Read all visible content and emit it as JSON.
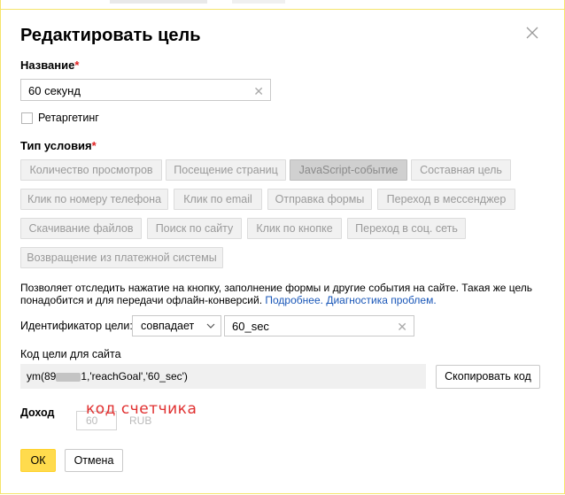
{
  "dialog": {
    "title": "Редактировать цель",
    "name_label": "Название",
    "required_mark": "*",
    "name_value": "60 секунд",
    "retargeting_label": "Ретаргетинг",
    "condition_label": "Тип условия",
    "condition_types": [
      "Количество просмотров",
      "Посещение страниц",
      "JavaScript-событие",
      "Составная цель",
      "Клик по номеру телефона",
      "Клик по email",
      "Отправка формы",
      "Переход в мессенджер",
      "Скачивание файлов",
      "Поиск по сайту",
      "Клик по кнопке",
      "Переход в соц. сеть",
      "Возвращение из платежной системы"
    ],
    "active_condition": "JavaScript-событие",
    "description": "Позволяет отследить нажатие на кнопку, заполнение формы и другие события на сайте. Такая же цель понадобится и для передачи офлайн-конверсий.",
    "link_more": "Подробнее.",
    "link_diag": "Диагностика проблем.",
    "goal_id_label": "Идентификатор цели:",
    "match_select_value": "совпадает",
    "goal_id_value": "60_sec",
    "code_label": "Код цели для сайта",
    "code_prefix": "ym(89",
    "code_suffix": "1,'reachGoal','60_sec')",
    "copy_button": "Скопировать код",
    "income_label": "Доход",
    "income_value": "60",
    "currency": "RUB",
    "annotation": "код счетчика",
    "ok_button": "ОК",
    "cancel_button": "Отмена"
  },
  "colors": {
    "accent": "#ffdb4d",
    "link": "#1a57b8",
    "required": "#e02020",
    "annotation": "#e03030"
  }
}
